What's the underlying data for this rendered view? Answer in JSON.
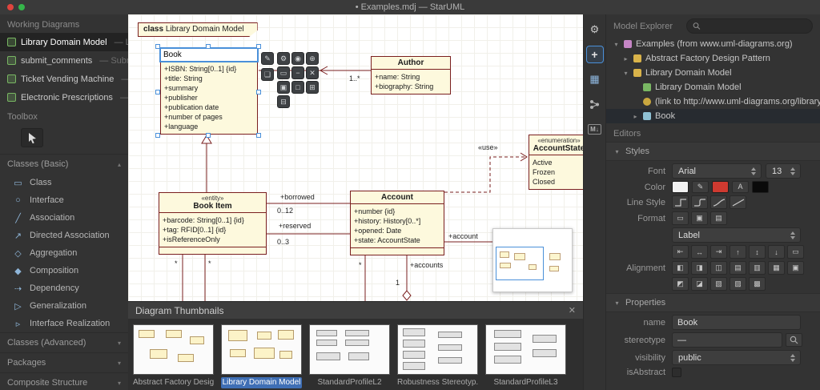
{
  "colors": {
    "accent_blue": "#4a90d9",
    "uml_border": "#7a1f1f",
    "uml_fill": "#fdf9dd",
    "selected_caption_bg": "#3f6fb5",
    "swatch_white": "#f2f2f2",
    "swatch_red": "#cf3a30",
    "swatch_black": "#0a0a0a"
  },
  "icons": {
    "caret_up": "▴",
    "caret_down": "▾",
    "caret_right": "▸"
  },
  "titlebar": {
    "title": "• Examples.mdj — StarUML"
  },
  "sidebar": {
    "working_diagrams_header": "Working Diagrams",
    "diagrams": [
      {
        "name": "Library Domain Model",
        "suffix": "— Lib"
      },
      {
        "name": "submit_comments",
        "suffix": "— Submit"
      },
      {
        "name": "Ticket Vending Machine",
        "suffix": "— T"
      },
      {
        "name": "Electronic Prescriptions",
        "suffix": "— E"
      }
    ],
    "toolbox_header": "Toolbox",
    "sections": {
      "basic": "Classes (Basic)",
      "advanced": "Classes (Advanced)",
      "packages": "Packages",
      "composite": "Composite Structure"
    },
    "tools": [
      {
        "glyph": "▭",
        "label": "Class"
      },
      {
        "glyph": "○",
        "label": "Interface"
      },
      {
        "glyph": "╱",
        "label": "Association"
      },
      {
        "glyph": "↗",
        "label": "Directed Association"
      },
      {
        "glyph": "◇",
        "label": "Aggregation"
      },
      {
        "glyph": "◆",
        "label": "Composition"
      },
      {
        "glyph": "⇢",
        "label": "Dependency"
      },
      {
        "glyph": "▷",
        "label": "Generalization"
      },
      {
        "glyph": "▹",
        "label": "Interface Realization"
      }
    ]
  },
  "canvas": {
    "frame_keyword": "class",
    "frame_name": "Library Domain Model",
    "book": {
      "name": "Book",
      "attributes": [
        "+ISBN: String[0..1] {id}",
        "+title: String",
        "+summary",
        "+publisher",
        "+publication date",
        "+number of pages",
        "+language"
      ]
    },
    "author": {
      "name": "Author",
      "attributes": [
        "+name: String",
        "+biography: String"
      ]
    },
    "book_item": {
      "stereotype": "«entity»",
      "name": "Book Item",
      "attributes": [
        "+barcode: String[0..1] {id}",
        "+tag: RFID[0..1] {id}",
        "+isReferenceOnly"
      ]
    },
    "account": {
      "name": "Account",
      "attributes": [
        "+number {id}",
        "+history: History[0..*]",
        "+opened: Date",
        "+state: AccountState"
      ]
    },
    "enumeration": {
      "stereotype": "«enumeration»",
      "name": "AccountState",
      "literals": [
        "Active",
        "Frozen",
        "Closed"
      ]
    },
    "labels": {
      "author_mult": "1..*",
      "use": "«use»",
      "borrowed": "+borrowed",
      "borrowed_mult": "0..12",
      "reserved": "+reserved",
      "reserved_mult": "0..3",
      "account_role": "+account",
      "accounts_role": "+accounts",
      "one": "1",
      "many": "*"
    },
    "edit_toolbar_glyphs": [
      "✎",
      "❏",
      "⚙",
      "◉",
      "⊕",
      "▭",
      "−",
      "✕",
      "▣",
      "□",
      "⊞",
      "⊟"
    ]
  },
  "thumbnails": {
    "title": "Diagram Thumbnails",
    "close_glyph": "✕",
    "items": [
      {
        "label": "Abstract Factory Desig..."
      },
      {
        "label": "Library Domain Model"
      },
      {
        "label": "StandardProfileL2"
      },
      {
        "label": "Robustness Stereotyp..."
      },
      {
        "label": "StandardProfileL3"
      }
    ]
  },
  "right_strip": {
    "tools_glyph": "⚙",
    "crosshair_glyph": "+",
    "grid_glyph": "▦",
    "markdown_glyph": "M↓"
  },
  "explorer": {
    "header": "Model Explorer",
    "tree": [
      {
        "caret": "▾",
        "label": "Examples (from www.uml-diagrams.org)"
      },
      {
        "caret": "▸",
        "label": "Abstract Factory Design Pattern"
      },
      {
        "caret": "▾",
        "label": "Library Domain Model"
      },
      {
        "caret": "",
        "label": "Library Domain Model"
      },
      {
        "caret": "",
        "label": "(link to http://www.uml-diagrams.org/library-"
      },
      {
        "caret": "▸",
        "label": "Book"
      }
    ]
  },
  "editors": {
    "header": "Editors",
    "styles_label": "Styles",
    "font_label": "Font",
    "font_value": "Arial",
    "font_size": "13",
    "color_label": "Color",
    "pencil_glyph": "✎",
    "font_color_glyph": "A",
    "line_style_label": "Line Style",
    "format_label": "Format",
    "format_glyphs": [
      "▭",
      "▣",
      "▤"
    ],
    "label_dropdown": "Label",
    "distribute_glyphs": [
      "⇤",
      "↔",
      "⇥",
      "↑",
      "↕",
      "↓",
      "▭"
    ],
    "alignment_label": "Alignment",
    "align_glyphs_1": [
      "◧",
      "◨",
      "◫",
      "▤",
      "▥",
      "▦",
      "▣"
    ],
    "align_glyphs_2": [
      "◩",
      "◪",
      "▧",
      "▨",
      "▩"
    ],
    "properties_label": "Properties",
    "prop_name_label": "name",
    "prop_name_value": "Book",
    "prop_stereotype_label": "stereotype",
    "prop_stereotype_value": "—",
    "prop_visibility_label": "visibility",
    "prop_visibility_value": "public",
    "prop_isabstract_label": "isAbstract"
  }
}
